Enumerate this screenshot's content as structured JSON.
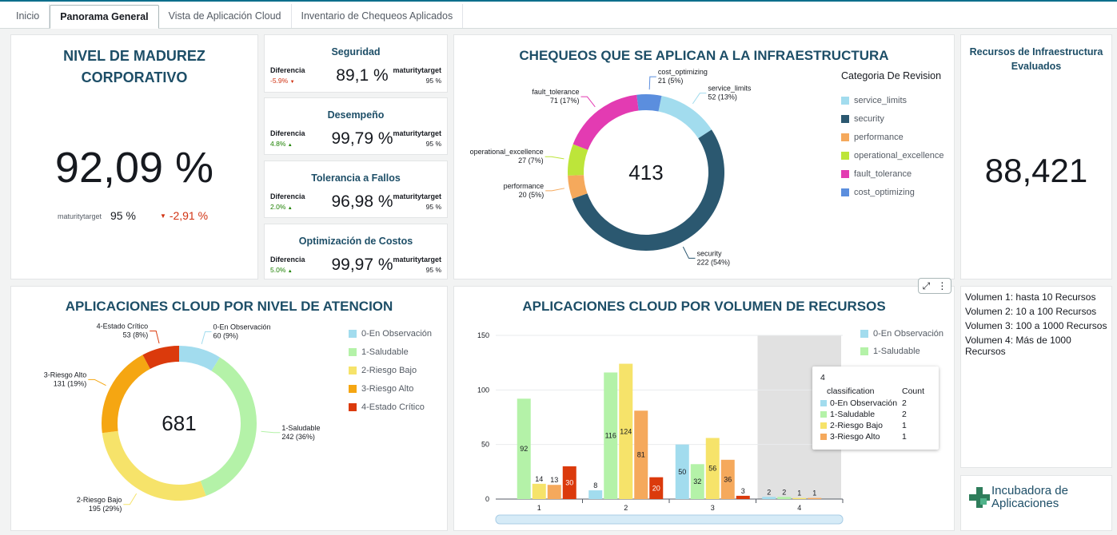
{
  "tabs": [
    "Inicio",
    "Panorama General",
    "Vista de Aplicación Cloud",
    "Inventario de Chequeos Aplicados"
  ],
  "active_tab": 1,
  "maturity": {
    "title": "NIVEL DE MADUREZ CORPORATIVO",
    "value": "92,09 %",
    "target_label": "maturitytarget",
    "target_value": "95 %",
    "diff": "-2,91 %"
  },
  "kpis": [
    {
      "title": "Seguridad",
      "diff_label": "Diferencia",
      "diff": "-5.9%",
      "diff_dir": "down",
      "value": "89,1 %",
      "target_label": "maturitytarget",
      "target": "95 %"
    },
    {
      "title": "Desempeño",
      "diff_label": "Diferencia",
      "diff": "4.8%",
      "diff_dir": "up",
      "value": "99,79 %",
      "target_label": "maturitytarget",
      "target": "95 %"
    },
    {
      "title": "Tolerancia a Fallos",
      "diff_label": "Diferencia",
      "diff": "2.0%",
      "diff_dir": "up",
      "value": "96,98 %",
      "target_label": "maturitytarget",
      "target": "95 %"
    },
    {
      "title": "Optimización de Costos",
      "diff_label": "Diferencia",
      "diff": "5.0%",
      "diff_dir": "up",
      "value": "99,97 %",
      "target_label": "maturitytarget",
      "target": "95 %"
    }
  ],
  "resources": {
    "title": "Recursos de Infraestructura Evaluados",
    "value": "88,421"
  },
  "volumes": [
    {
      "label": "Volumen 1:",
      "desc": "hasta 10 Recursos"
    },
    {
      "label": "Volumen 2:",
      "desc": "10 a 100 Recursos"
    },
    {
      "label": "Volumen 3:",
      "desc": "100 a 1000 Recursos"
    },
    {
      "label": "Volumen 4:",
      "desc": "Más de 1000 Recursos"
    }
  ],
  "logo_text": [
    "Incubadora de",
    "Aplicaciones"
  ],
  "colors": {
    "accent": "#0b6f8c",
    "title": "#1d4e67",
    "negative": "#d13212",
    "positive": "#1d8102"
  },
  "chart_data": [
    {
      "type": "pie",
      "title": "CHEQUEOS QUE SE APLICAN A LA INFRAESTRUCTURA",
      "total": "413",
      "legend_title": "Categoria De Revision",
      "legend_position": "right",
      "slices": [
        {
          "name": "service_limits",
          "value": 52,
          "label": "52 (13%)",
          "color": "#a2dcee"
        },
        {
          "name": "security",
          "value": 222,
          "label": "222 (54%)",
          "color": "#2b5870"
        },
        {
          "name": "performance",
          "value": 20,
          "label": "20 (5%)",
          "color": "#f5a95c"
        },
        {
          "name": "operational_excellence",
          "value": 27,
          "label": "27 (7%)",
          "color": "#bde53a"
        },
        {
          "name": "fault_tolerance",
          "value": 71,
          "label": "71 (17%)",
          "color": "#e33bb2"
        },
        {
          "name": "cost_optimizing",
          "value": 21,
          "label": "21 (5%)",
          "color": "#5b8ede"
        }
      ]
    },
    {
      "type": "pie",
      "title": "APLICACIONES CLOUD POR NIVEL DE ATENCION",
      "total": "681",
      "legend_position": "right",
      "slices": [
        {
          "name": "0-En Observación",
          "value": 60,
          "label": "60 (9%)",
          "color": "#a2dcee"
        },
        {
          "name": "1-Saludable",
          "value": 242,
          "label": "242 (36%)",
          "color": "#b4f2a8"
        },
        {
          "name": "2-Riesgo Bajo",
          "value": 195,
          "label": "195 (29%)",
          "color": "#f6e36a"
        },
        {
          "name": "3-Riesgo Alto",
          "value": 131,
          "label": "131 (19%)",
          "color": "#f5a612"
        },
        {
          "name": "4-Estado Crítico",
          "value": 53,
          "label": "53 (8%)",
          "color": "#db3a0c"
        }
      ]
    },
    {
      "type": "bar",
      "title": "APLICACIONES CLOUD POR VOLUMEN DE RECURSOS",
      "categories": [
        "1",
        "2",
        "3",
        "4"
      ],
      "ylim": [
        0,
        150
      ],
      "yticks": [
        0,
        50,
        100,
        150
      ],
      "legend_position": "top-right",
      "highlight_category": "4",
      "series": [
        {
          "name": "0-En Observación",
          "color": "#a2dcee",
          "values": [
            null,
            8,
            50,
            2
          ]
        },
        {
          "name": "1-Saludable",
          "color": "#b4f2a8",
          "values": [
            92,
            116,
            32,
            2
          ]
        },
        {
          "name": "2-Riesgo Bajo",
          "color": "#f6e36a",
          "values": [
            14,
            124,
            56,
            1
          ]
        },
        {
          "name": "3-Riesgo Alto",
          "color": "#f5a95c",
          "values": [
            13,
            81,
            36,
            1
          ]
        },
        {
          "name": "4-Estado Crítico",
          "color": "#db3a0c",
          "values": [
            30,
            20,
            3,
            null
          ]
        }
      ],
      "tooltip": {
        "category": "4",
        "header_left": "classification",
        "header_right": "Count",
        "rows": [
          {
            "name": "0-En Observación",
            "count": "2",
            "color": "#a2dcee"
          },
          {
            "name": "1-Saludable",
            "count": "2",
            "color": "#b4f2a8"
          },
          {
            "name": "2-Riesgo Bajo",
            "count": "1",
            "color": "#f6e36a"
          },
          {
            "name": "3-Riesgo Alto",
            "count": "1",
            "color": "#f5a95c"
          }
        ]
      }
    }
  ]
}
